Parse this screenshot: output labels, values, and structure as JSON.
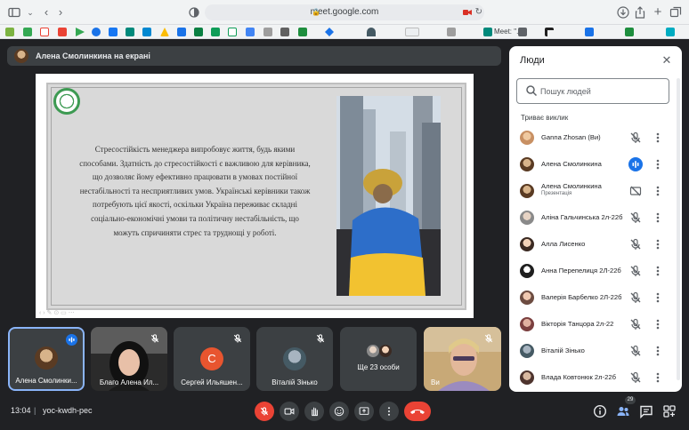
{
  "browser": {
    "url": "meet.google.com",
    "tabs": [
      {
        "label": "Meet: \"..."
      }
    ]
  },
  "presenter": {
    "label": "Алена Смолинкина на екрані"
  },
  "slide": {
    "text": "Стресостійкість менеджера випробовує життя, будь якими способами. Здатність до стресостійкості є важливою для керівника, що дозволяє йому ефективно працювати в умовах постійної нестабільності та несприятливих умов. Українські керівники також потребують цієї якості, оскільки Україна переживає складні соціально-економічні умови та політичну нестабільність, що можуть спричиняти стрес та труднощі у роботі."
  },
  "people_panel": {
    "title": "Люди",
    "search_placeholder": "Пошук людей",
    "section": "Триває виклик",
    "participants": [
      {
        "name": "Ganna Zhosan (Ви)",
        "sub": "",
        "mic": "muted"
      },
      {
        "name": "Алена Смолинкина",
        "sub": "",
        "mic": "speaking"
      },
      {
        "name": "Алена Смолинкина",
        "sub": "Презентація",
        "mic": "presenting"
      },
      {
        "name": "Аліна Гальчинська 2л-22б",
        "sub": "",
        "mic": "muted"
      },
      {
        "name": "Алла Лисенко",
        "sub": "",
        "mic": "muted"
      },
      {
        "name": "Анна Перепелиця 2Л-22б",
        "sub": "",
        "mic": "muted"
      },
      {
        "name": "Валерія Барбелко 2Л-22б",
        "sub": "",
        "mic": "muted"
      },
      {
        "name": "Вікторія Танцора 2л-22",
        "sub": "",
        "mic": "muted"
      },
      {
        "name": "Віталій Зінько",
        "sub": "",
        "mic": "muted"
      },
      {
        "name": "Влада Ковтонюк 2л-22б",
        "sub": "",
        "mic": "muted"
      }
    ]
  },
  "tiles": [
    {
      "name": "Алена Смолинки..."
    },
    {
      "name": "Благо Алена Ил..."
    },
    {
      "name": "Сергей Ильяшен...",
      "initial": "C"
    },
    {
      "name": "Віталій Зінько"
    },
    {
      "name": "Ще 23 особи"
    },
    {
      "name": "Ви"
    }
  ],
  "bottom": {
    "time": "13:04",
    "separator": "|",
    "meeting_code": "yoc-kwdh-pec",
    "participants_count": "29"
  },
  "colors": {
    "background": "#202124",
    "tile": "#3c4043",
    "leave_red": "#ea4335",
    "accent_blue": "#1a73e8"
  }
}
